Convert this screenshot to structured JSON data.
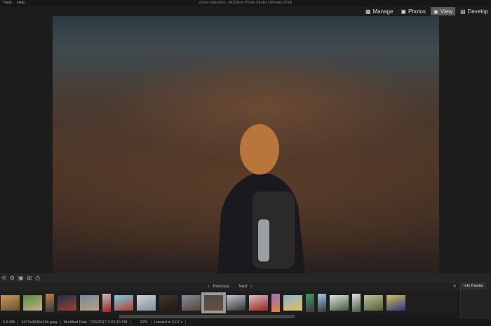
{
  "menu": [
    "Tools",
    "Help"
  ],
  "title": "noise-reduction - ACDSee Photo Studio Ultimate 2018",
  "modes": [
    {
      "label": "Manage",
      "icon": "grid-icon"
    },
    {
      "label": "Photos",
      "icon": "photos-icon"
    },
    {
      "label": "View",
      "icon": "eye-icon",
      "active": true
    },
    {
      "label": "Develop",
      "icon": "develop-icon"
    }
  ],
  "filmstrip": {
    "previous": "Previous",
    "next": "Next",
    "close": "×",
    "thumbs": [
      [
        "#c89a5a",
        "#6a5030",
        "land"
      ],
      [
        "#5a8a3a",
        "#c8b090",
        "land"
      ],
      [
        "#c08040",
        "#303840",
        "portrait"
      ],
      [
        "#203050",
        "#a04030",
        "land"
      ],
      [
        "#708aa0",
        "#c0a080",
        "land"
      ],
      [
        "#c0c0c0",
        "#a02020",
        "portrait"
      ],
      [
        "#80c8e0",
        "#b04030",
        "land"
      ],
      [
        "#d0d0d0",
        "#8090a0",
        "land"
      ],
      [
        "#403830",
        "#201810",
        "land"
      ],
      [
        "#8090a0",
        "#604030",
        "land"
      ],
      [
        "#4a4a4a",
        "#6a5040",
        "land",
        "selected"
      ],
      [
        "#c0c8d0",
        "#303030",
        "land"
      ],
      [
        "#d0c0c0",
        "#a02020",
        "land"
      ],
      [
        "#a070c0",
        "#e08040",
        "portrait"
      ],
      [
        "#90b0d0",
        "#e0c060",
        "land"
      ],
      [
        "#30a060",
        "#503040",
        "portrait"
      ],
      [
        "#a0c8e8",
        "#303840",
        "portrait"
      ],
      [
        "#e0e0e0",
        "#406040",
        "land"
      ],
      [
        "#e0e0e0",
        "#406040",
        "portrait"
      ],
      [
        "#c0c0a0",
        "#506030",
        "land"
      ],
      [
        "#d0c060",
        "#303080",
        "land"
      ]
    ]
  },
  "info_palette": {
    "title": "Info Palette"
  },
  "status": [
    "5.6 MB",
    "5472x3648x24b jpeg",
    "Modified Date: 7/25/2017 3:22:40 PM",
    "",
    "22%",
    "Loaded in 0.07 s"
  ]
}
